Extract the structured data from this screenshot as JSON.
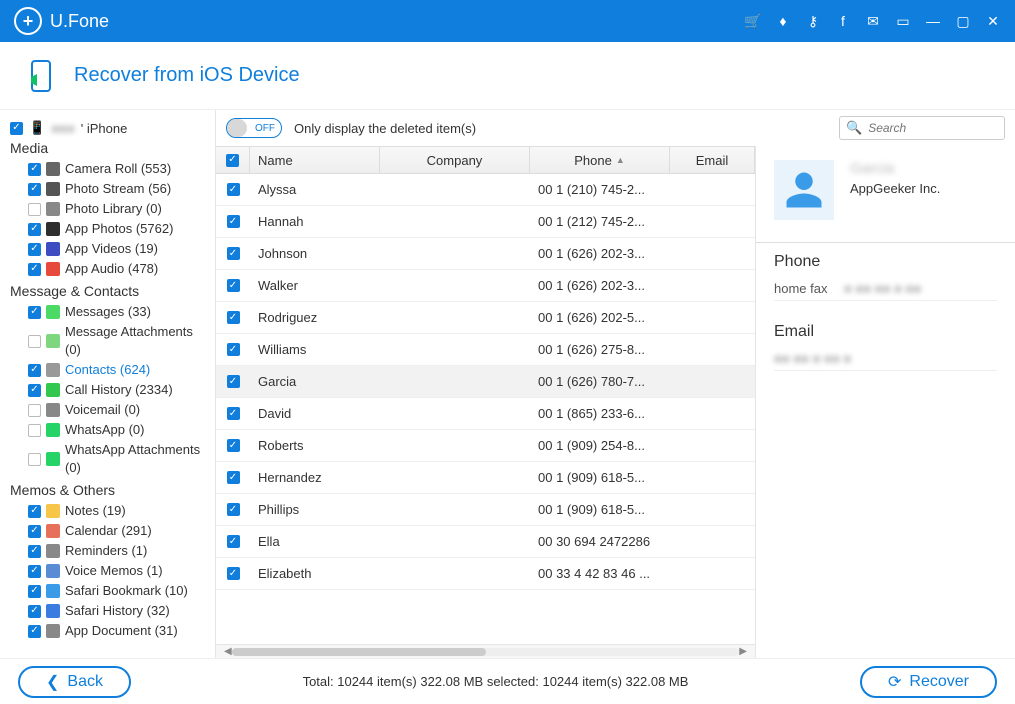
{
  "app": {
    "name": "U.Fone"
  },
  "header": {
    "title": "Recover from iOS Device"
  },
  "device": {
    "name": "' iPhone"
  },
  "sidebar": {
    "sections": [
      {
        "title": "Media",
        "items": [
          {
            "key": "camera",
            "label": "Camera Roll (553)",
            "checked": true,
            "color": "#666"
          },
          {
            "key": "pstream",
            "label": "Photo Stream (56)",
            "checked": true,
            "color": "#555"
          },
          {
            "key": "plib",
            "label": "Photo Library (0)",
            "checked": false,
            "color": "#888"
          },
          {
            "key": "aphotos",
            "label": "App Photos (5762)",
            "checked": true,
            "color": "#2e2e2e"
          },
          {
            "key": "avideos",
            "label": "App Videos (19)",
            "checked": true,
            "color": "#3d4cc0"
          },
          {
            "key": "aaudio",
            "label": "App Audio (478)",
            "checked": true,
            "color": "#e64a3a"
          }
        ]
      },
      {
        "title": "Message & Contacts",
        "items": [
          {
            "key": "messages",
            "label": "Messages (33)",
            "checked": true,
            "color": "#4cd964"
          },
          {
            "key": "msgatt",
            "label": "Message Attachments (0)",
            "checked": false,
            "color": "#7ed77e"
          },
          {
            "key": "contacts",
            "label": "Contacts (624)",
            "checked": true,
            "color": "#999",
            "selected": true
          },
          {
            "key": "callhist",
            "label": "Call History (2334)",
            "checked": true,
            "color": "#32c850"
          },
          {
            "key": "voicemail",
            "label": "Voicemail (0)",
            "checked": false,
            "color": "#888"
          },
          {
            "key": "wa",
            "label": "WhatsApp (0)",
            "checked": false,
            "color": "#25d366"
          },
          {
            "key": "waatt",
            "label": "WhatsApp Attachments (0)",
            "checked": false,
            "color": "#25d366"
          }
        ]
      },
      {
        "title": "Memos & Others",
        "items": [
          {
            "key": "notes",
            "label": "Notes (19)",
            "checked": true,
            "color": "#f7c548"
          },
          {
            "key": "calendar",
            "label": "Calendar (291)",
            "checked": true,
            "color": "#e6705a"
          },
          {
            "key": "reminders",
            "label": "Reminders (1)",
            "checked": true,
            "color": "#888"
          },
          {
            "key": "vmemos",
            "label": "Voice Memos (1)",
            "checked": true,
            "color": "#5a8cd6"
          },
          {
            "key": "sbm",
            "label": "Safari Bookmark (10)",
            "checked": true,
            "color": "#3a9be8"
          },
          {
            "key": "shist",
            "label": "Safari History (32)",
            "checked": true,
            "color": "#3a7ce0"
          },
          {
            "key": "adoc",
            "label": "App Document (31)",
            "checked": true,
            "color": "#888"
          }
        ]
      }
    ]
  },
  "toolbar": {
    "toggle_state": "OFF",
    "toggle_label": "Only display the deleted item(s)",
    "search_placeholder": "Search"
  },
  "table": {
    "headers": {
      "name": "Name",
      "company": "Company",
      "phone": "Phone",
      "email": "Email"
    },
    "rows": [
      {
        "name": "Alyssa",
        "company": "",
        "phone": "00 1 (210) 745-2...",
        "email": ""
      },
      {
        "name": "Hannah",
        "company": "",
        "phone": "00 1 (212) 745-2...",
        "email": ""
      },
      {
        "name": "Johnson",
        "company": "",
        "phone": "00 1 (626) 202-3...",
        "email": ""
      },
      {
        "name": "Walker",
        "company": "",
        "phone": "00 1 (626) 202-3...",
        "email": ""
      },
      {
        "name": "Rodriguez",
        "company": "",
        "phone": "00 1 (626) 202-5...",
        "email": ""
      },
      {
        "name": "Williams",
        "company": "",
        "phone": "00 1 (626) 275-8...",
        "email": ""
      },
      {
        "name": "Garcia",
        "company": "",
        "phone": "00 1 (626) 780-7...",
        "email": "",
        "selected": true
      },
      {
        "name": "David",
        "company": "",
        "phone": "00 1 (865) 233-6...",
        "email": ""
      },
      {
        "name": "Roberts",
        "company": "",
        "phone": "00 1 (909) 254-8...",
        "email": ""
      },
      {
        "name": "Hernandez",
        "company": "",
        "phone": "00 1 (909) 618-5...",
        "email": ""
      },
      {
        "name": "Phillips",
        "company": "",
        "phone": "00 1 (909) 618-5...",
        "email": ""
      },
      {
        "name": "Ella",
        "company": "",
        "phone": "00 30 694 2472286",
        "email": ""
      },
      {
        "name": "Elizabeth",
        "company": "",
        "phone": "00 33 4 42 83 46 ...",
        "email": ""
      }
    ]
  },
  "detail": {
    "name": "Garcia",
    "company": "AppGeeker Inc.",
    "phone_header": "Phone",
    "phone_label": "home fax",
    "email_header": "Email"
  },
  "footer": {
    "back": "Back",
    "recover": "Recover",
    "status": "Total: 10244 item(s) 322.08 MB    selected: 10244 item(s) 322.08 MB"
  }
}
